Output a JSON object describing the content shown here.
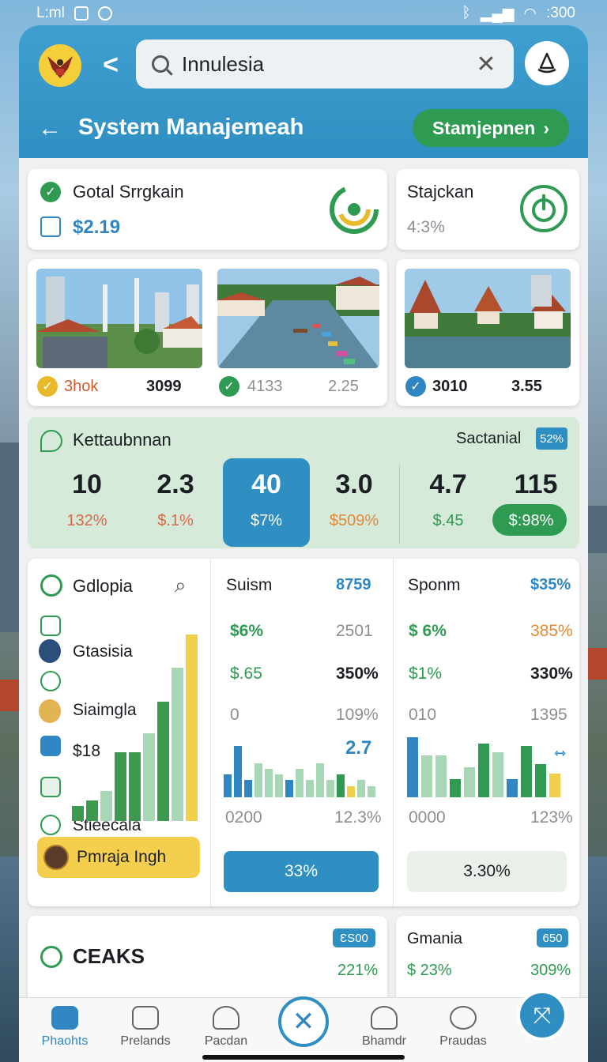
{
  "status_bar": {
    "left": "L:ml",
    "right": ":300"
  },
  "search": {
    "value": "Innulesia"
  },
  "header": {
    "title": "System Manajemeah",
    "primary_button": "Stamjepnen"
  },
  "card_total": {
    "title": "Gotal Srrgkain",
    "value": "$2.19"
  },
  "card_status": {
    "title": "Stajckan",
    "value": "4:3%"
  },
  "photos": [
    {
      "left_label": "3hok",
      "right_label": "3099"
    },
    {
      "left_label": "4133",
      "right_label": "2.25"
    },
    {
      "left_label": "3010",
      "right_label": "3.55"
    }
  ],
  "stats": {
    "title": "Kettaubnnan",
    "right_title": "Sactanial",
    "right_badge": "52%",
    "items": [
      {
        "value": "10",
        "sub": "132%",
        "sub_color": "#d9694a"
      },
      {
        "value": "2.3",
        "sub": "$.1%",
        "sub_color": "#d9694a"
      },
      {
        "value": "40",
        "sub": "$7%",
        "sub_color": "#ffffff"
      },
      {
        "value": "3.0",
        "sub": "$509%",
        "sub_color": "#e08a3a"
      },
      {
        "value": "4.7",
        "sub": "$.45",
        "sub_color": "#2e9a52"
      },
      {
        "value": "115",
        "sub": "$:98%",
        "sub_color": "#ffffff"
      }
    ]
  },
  "panel_left": {
    "title": "Gdlopia",
    "items": [
      "Gtasisia",
      "Siaimgla",
      "$18",
      "Stieecala"
    ],
    "bars": [
      0.08,
      0.11,
      0.16,
      0.37,
      0.37,
      0.47,
      0.64,
      0.82,
      1.0
    ],
    "footer": "Pmraja Ingh"
  },
  "panel_mid": {
    "title": "Suism",
    "title_value": "8759",
    "rows": [
      {
        "a": "$6%",
        "b": "2501"
      },
      {
        "a": "$.65",
        "b": "350%"
      },
      {
        "a": "0",
        "b": "109%"
      }
    ],
    "highlight": "2.7",
    "axis_left": "0200",
    "axis_right": "12.3%",
    "button": "33%",
    "bars": [
      0.4,
      0.9,
      0.3,
      0.6,
      0.5,
      0.4,
      0.3,
      0.5,
      0.3,
      0.6,
      0.3,
      0.4,
      0.2,
      0.3,
      0.2
    ]
  },
  "panel_right": {
    "title": "Sрonm",
    "title_value": "$35%",
    "rows": [
      {
        "a": "$ 6%",
        "b": "385%"
      },
      {
        "a": "$1%",
        "b": "330%"
      },
      {
        "a": "010",
        "b": "1395"
      }
    ],
    "axis_left": "0000",
    "axis_right": "123%",
    "button": "3.30%",
    "bars": [
      1.0,
      0.7,
      0.7,
      0.3,
      0.5,
      0.9,
      0.75,
      0.3,
      0.85,
      0.55,
      0.4
    ]
  },
  "card_bottom_left": {
    "title": "CEAKS",
    "badge": "ƐS00",
    "value": "221%"
  },
  "card_bottom_right": {
    "title": "Gmania",
    "badge": "650",
    "left": "$ 23%",
    "right": "309%"
  },
  "nav": [
    "Phaohts",
    "Prelands",
    "Pacdan",
    "Bhamdr",
    "Praudas"
  ]
}
